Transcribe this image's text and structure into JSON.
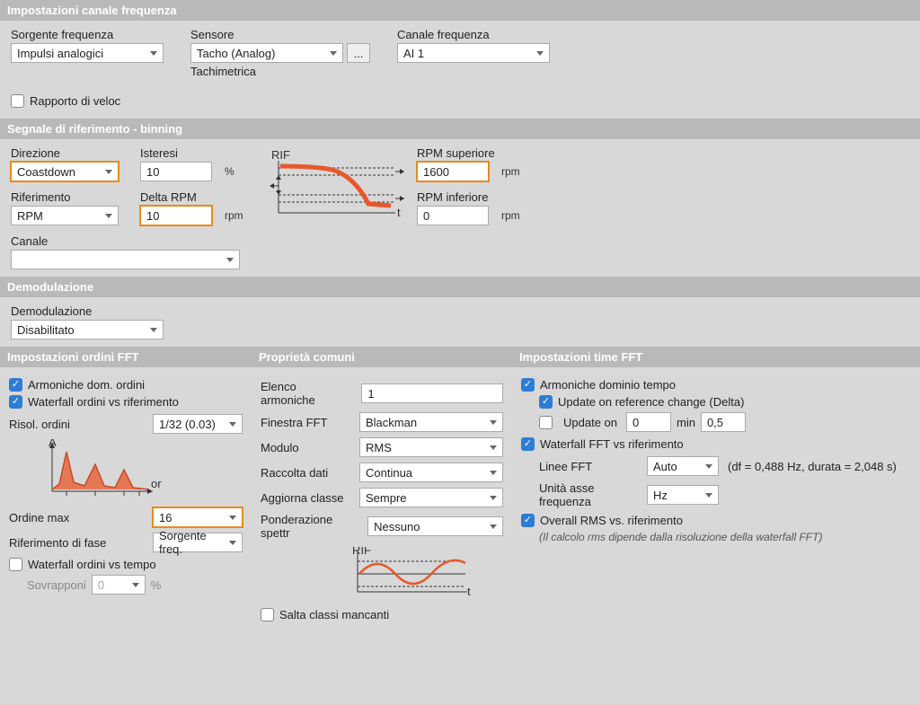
{
  "sections": {
    "freq": {
      "title": "Impostazioni canale frequenza",
      "sorgente_label": "Sorgente frequenza",
      "sorgente_value": "Impulsi analogici",
      "sensore_label": "Sensore",
      "sensore_value": "Tacho (Analog)",
      "sensore_sub": "Tachimetrica",
      "canale_label": "Canale frequenza",
      "canale_value": "AI 1",
      "rapporto_label": "Rapporto di veloc"
    },
    "ref": {
      "title": "Segnale di riferimento - binning",
      "direzione_label": "Direzione",
      "direzione_value": "Coastdown",
      "isteresi_label": "Isteresi",
      "isteresi_value": "10",
      "isteresi_unit": "%",
      "riferimento_label": "Riferimento",
      "riferimento_value": "RPM",
      "delta_label": "Delta RPM",
      "delta_value": "10",
      "delta_unit": "rpm",
      "rpm_sup_label": "RPM superiore",
      "rpm_sup_value": "1600",
      "rpm_sup_unit": "rpm",
      "rpm_inf_label": "RPM inferiore",
      "rpm_inf_value": "0",
      "rpm_inf_unit": "rpm",
      "canale_label": "Canale",
      "canale_value": ""
    },
    "demod": {
      "title": "Demodulazione",
      "label": "Demodulazione",
      "value": "Disabilitato"
    },
    "ordfft": {
      "title": "Impostazioni ordini FFT",
      "arm_ord": "Armoniche dom. ordini",
      "wf_ord_ref": "Waterfall ordini vs riferimento",
      "risol_label": "Risol. ordini",
      "risol_value": "1/32 (0.03)",
      "ord_max_label": "Ordine max",
      "ord_max_value": "16",
      "rif_fase_label": "Riferimento di fase",
      "rif_fase_value": "Sorgente freq.",
      "wf_ord_tempo": "Waterfall ordini vs tempo",
      "sovrapponi_label": "Sovrapponi",
      "sovrapponi_value": "0",
      "sovrapponi_unit": "%"
    },
    "common": {
      "title": "Proprietà comuni",
      "elenco_label": "Elenco armoniche",
      "elenco_value": "1",
      "finestra_label": "Finestra FFT",
      "finestra_value": "Blackman",
      "modulo_label": "Modulo",
      "modulo_value": "RMS",
      "raccolta_label": "Raccolta dati",
      "raccolta_value": "Continua",
      "aggiorna_label": "Aggiorna classe",
      "aggiorna_value": "Sempre",
      "ponder_label": "Ponderazione spettr",
      "ponder_value": "Nessuno",
      "salta": "Salta classi mancanti"
    },
    "timefft": {
      "title": "Impostazioni time FFT",
      "arm_tempo": "Armoniche dominio tempo",
      "update_ref": "Update on reference change (Delta)",
      "update_on": "Update on",
      "update_on_val": "0",
      "update_on_unit": "min",
      "update_on_val2": "0,5",
      "wf_fft_ref": "Waterfall FFT vs riferimento",
      "linee_label": "Linee FFT",
      "linee_value": "Auto",
      "linee_note": "(df = 0,488 Hz, durata = 2,048 s)",
      "unita_label": "Unità asse frequenza",
      "unita_value": "Hz",
      "overall": "Overall RMS vs. riferimento",
      "overall_note": "(Il calcolo rms dipende dalla risoluzione della waterfall FFT)"
    }
  }
}
